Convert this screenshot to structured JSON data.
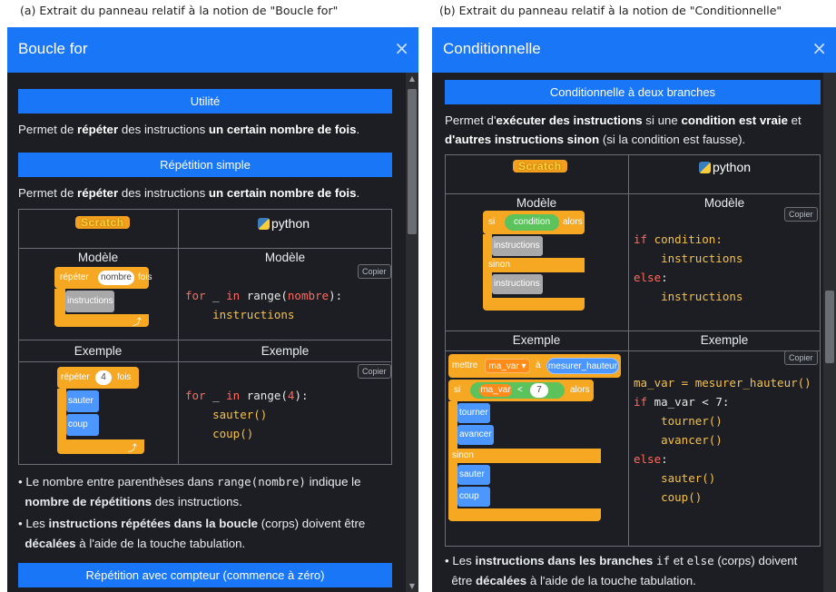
{
  "captions": {
    "left": "(a) Extrait du panneau relatif à la notion de \"Boucle for\"",
    "right": "(b) Extrait du panneau relatif à la notion de \"Conditionnelle\""
  },
  "icons": {
    "close": "close-icon",
    "scratch": "scratch-logo",
    "python": "python-logo"
  },
  "colors": {
    "accent": "#1976f6",
    "panel_bg": "#1c1e23",
    "keyword": "#ff6a5e",
    "function": "#f6c14b"
  },
  "left": {
    "title": "Boucle for",
    "close": "×",
    "sec_utilite": "Utilité",
    "utilite_text": {
      "a": "Permet de ",
      "b": "répéter",
      "c": " des instructions ",
      "d": "un certain nombre de fois",
      "e": "."
    },
    "sec_repet": "Répétition simple",
    "repet_text": {
      "a": "Permet de ",
      "b": "répéter",
      "c": " des instructions ",
      "d": "un certain nombre de fois",
      "e": "."
    },
    "scratch_label": "Scratch",
    "python_label": "python",
    "modele": "Modèle",
    "exemple": "Exemple",
    "copy": "Copier",
    "code1": {
      "l1a": "for",
      "l1b": " _ ",
      "l1c": "in",
      "l1d": " range(",
      "l1e": "nombre",
      "l1f": "):",
      "l2": "    instructions"
    },
    "code2": {
      "l1a": "for",
      "l1b": " _ ",
      "l1c": "in",
      "l1d": " range(",
      "l1e": "4",
      "l1f": "):",
      "l2": "    sauter()",
      "l3": "    coup()"
    },
    "blk1": {
      "repeat": "répéter",
      "pill": "nombre",
      "fois": "fois",
      "inner": "instructions"
    },
    "blk2": {
      "repeat": "répéter",
      "pill": "4",
      "fois": "fois",
      "a": "sauter",
      "b": "coup"
    },
    "bullet1": {
      "a": "Le nombre entre parenthèses dans ",
      "code1": "range(",
      "code2": "nombre",
      "code3": ")",
      "b": " indique le ",
      "c": "nombre de répétitions",
      "d": " des instructions."
    },
    "bullet2": {
      "a": "Les ",
      "b": "instructions répétées dans la boucle",
      "c": " (corps) doivent être ",
      "d": "décalées",
      "e": " à l'aide de la touche tabulation."
    },
    "sec_compteur": "Répétition avec compteur (commence à zéro)"
  },
  "right": {
    "title": "Conditionnelle",
    "close": "×",
    "sec": "Conditionnelle à deux branches",
    "text": {
      "a": "Permet d'",
      "b": "exécuter des instructions",
      "c": " si une ",
      "d": "condition est vraie",
      "e": " et ",
      "f": "d'autres instructions sinon",
      "g": " (si la condition est fausse)."
    },
    "scratch_label": "Scratch",
    "python_label": "python",
    "modele": "Modèle",
    "exemple": "Exemple",
    "copy": "Copier",
    "code1": {
      "l1a": "if",
      "l1b": " condition:",
      "l2": "    instructions",
      "l3": "else",
      "l3b": ":",
      "l4": "    instructions"
    },
    "code2": {
      "l1": "ma_var = mesurer_hauteur()",
      "l2a": "if",
      "l2b": " ma_var < 7:",
      "l3": "    tourner()",
      "l4": "    avancer()",
      "l5a": "else",
      "l5b": ":",
      "l6": "    sauter()",
      "l7": "    coup()"
    },
    "blk1": {
      "si": "si",
      "cond": "condition",
      "alors": "alors",
      "i1": "instructions",
      "sinon": "sinon",
      "i2": "instructions"
    },
    "blk2": {
      "mettre": "mettre",
      "var": "ma_var ▾",
      "a": "à",
      "sensor": "mesurer_hauteur",
      "si": "si",
      "var2": "ma_var",
      "lt": "<",
      "seven": "7",
      "alors": "alors",
      "t": "tourner",
      "av": "avancer",
      "sinon": "sinon",
      "s": "sauter",
      "c": "coup"
    },
    "bullet": {
      "a": "Les ",
      "b": "instructions dans les branches",
      "c": " ",
      "if": "if",
      "d": " et ",
      "else": "else",
      "e": " (corps) doivent",
      "f": "être ",
      "g": "décalées",
      "h": " à l'aide de la touche tabulation."
    }
  }
}
